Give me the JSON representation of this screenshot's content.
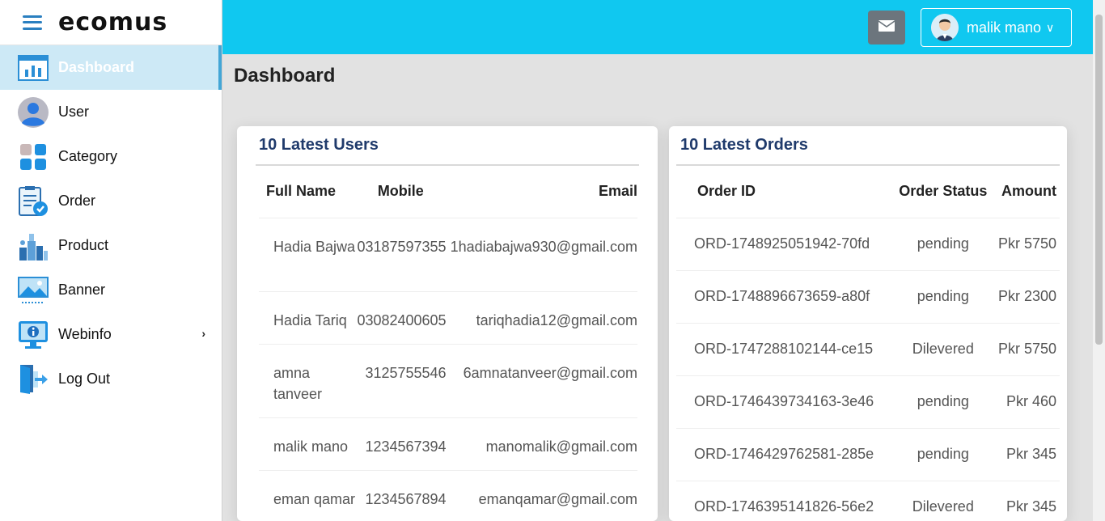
{
  "brand": {
    "logo": "ecomus"
  },
  "sidebar": {
    "items": [
      {
        "label": "Dashboard",
        "icon": "dashboard-icon"
      },
      {
        "label": "User",
        "icon": "user-icon"
      },
      {
        "label": "Category",
        "icon": "category-icon"
      },
      {
        "label": "Order",
        "icon": "order-icon"
      },
      {
        "label": "Product",
        "icon": "product-icon"
      },
      {
        "label": "Banner",
        "icon": "banner-icon"
      },
      {
        "label": "Webinfo",
        "icon": "webinfo-icon"
      },
      {
        "label": "Log Out",
        "icon": "logout-icon"
      }
    ]
  },
  "header": {
    "user_name": "malik mano",
    "mail_icon": "mail-icon"
  },
  "page": {
    "title": "Dashboard"
  },
  "users_card": {
    "title": "10 Latest Users",
    "columns": [
      "Full Name",
      "Mobile",
      "Email"
    ],
    "rows": [
      {
        "name": "Hadia Bajwa",
        "mobile": "03187597355",
        "email": "1hadiabajwa930@gmail.com"
      },
      {
        "name": "Hadia Tariq",
        "mobile": "03082400605",
        "email": "tariqhadia12@gmail.com"
      },
      {
        "name": "amna tanveer",
        "mobile": "3125755546",
        "email": "6amnatanveer@gmail.com"
      },
      {
        "name": "malik mano",
        "mobile": "1234567394",
        "email": "manomalik@gmail.com"
      },
      {
        "name": "eman qamar",
        "mobile": "1234567894",
        "email": "emanqamar@gmail.com"
      }
    ]
  },
  "orders_card": {
    "title": "10 Latest Orders",
    "columns": [
      "Order ID",
      "Order Status",
      "Amount"
    ],
    "rows": [
      {
        "id": "ORD-1748925051942-70fd",
        "status": "pending",
        "amount": "Pkr 5750"
      },
      {
        "id": "ORD-1748896673659-a80f",
        "status": "pending",
        "amount": "Pkr 2300"
      },
      {
        "id": "ORD-1747288102144-ce15",
        "status": "Dilevered",
        "amount": "Pkr 5750"
      },
      {
        "id": "ORD-1746439734163-3e46",
        "status": "pending",
        "amount": "Pkr 460"
      },
      {
        "id": "ORD-1746429762581-285e",
        "status": "pending",
        "amount": "Pkr 345"
      },
      {
        "id": "ORD-1746395141826-56e2",
        "status": "Dilevered",
        "amount": "Pkr 345"
      }
    ]
  }
}
